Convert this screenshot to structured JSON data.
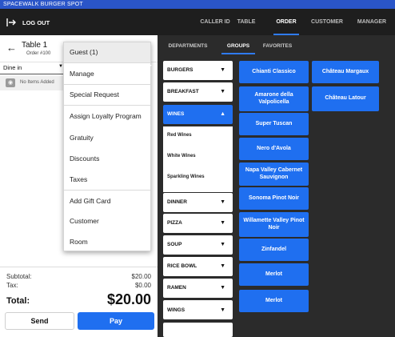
{
  "app": {
    "title": "SPACEWALK BURGER SPOT"
  },
  "header": {
    "logout_label": "LOG OUT",
    "tabs": [
      {
        "label": "CALLER ID",
        "active": false
      },
      {
        "label": "TABLE",
        "active": false
      },
      {
        "label": "ORDER",
        "active": true
      },
      {
        "label": "CUSTOMER",
        "active": false
      },
      {
        "label": "MANAGER",
        "active": false
      }
    ]
  },
  "ticket": {
    "table_title": "Table 1",
    "order_number": "Order #100",
    "order_type": "Dine in",
    "empty_label": "No Items Added",
    "subtotal_label": "Subtotal:",
    "subtotal_value": "$20.00",
    "tax_label": "Tax:",
    "tax_value": "$0.00",
    "total_label": "Total:",
    "total_value": "$20.00",
    "send_label": "Send",
    "pay_label": "Pay"
  },
  "menu": {
    "items": [
      "Guest (1)",
      "Manage",
      "Special Request",
      "Assign Loyalty Program",
      "Gratuity",
      "Discounts",
      "Taxes",
      "Add Gift Card",
      "Customer",
      "Room"
    ]
  },
  "subtabs": [
    {
      "label": "DEPARTMENTS",
      "active": false
    },
    {
      "label": "GROUPS",
      "active": true
    },
    {
      "label": "FAVORITES",
      "active": false
    }
  ],
  "categories": [
    {
      "label": "BURGERS",
      "expanded": false
    },
    {
      "label": "BREAKFAST",
      "expanded": false
    },
    {
      "label": "WINES",
      "expanded": true
    },
    {
      "label": "DINNER",
      "expanded": false
    },
    {
      "label": "PIZZA",
      "expanded": false
    },
    {
      "label": "SOUP",
      "expanded": false
    },
    {
      "label": "RICE BOWL",
      "expanded": false
    },
    {
      "label": "RAMEN",
      "expanded": false
    },
    {
      "label": "WINGS",
      "expanded": false
    }
  ],
  "wine_subcategories": [
    "Red Wines",
    "White Wines",
    "Sparkling Wines"
  ],
  "items_col1": [
    "Chianti Classico",
    "Amarone della Valpolicella",
    "Super Tuscan",
    "Nero d'Avola",
    "Napa Valley Cabernet Sauvignon",
    "Sonoma Pinot Noir",
    "Willamette Valley Pinot Noir",
    "Zinfandel",
    "Merlot",
    "Merlot"
  ],
  "items_col2": [
    "Château Margaux",
    "Château Latour"
  ],
  "colors": {
    "accent": "#1f6ff0",
    "title_bar": "#2a55c8",
    "nav_bar": "#1e1e1e",
    "background": "#2b2b2b"
  }
}
